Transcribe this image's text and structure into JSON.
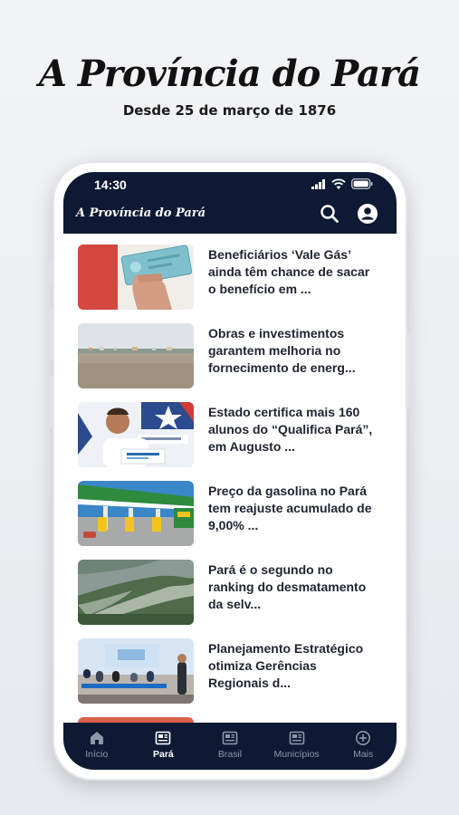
{
  "brand": {
    "logo": "A Província do Pará",
    "tagline": "Desde 25 de março de 1876"
  },
  "status_bar": {
    "time": "14:30"
  },
  "app_bar": {
    "logo": "A Província do Pará",
    "icons": [
      "search-icon",
      "account-icon"
    ]
  },
  "news": [
    {
      "title": "Beneficiários ‘Vale Gás’ ainda têm chance de sacar o benefício em ..."
    },
    {
      "title": "Obras e investimentos garantem melhoria no fornecimento de energ..."
    },
    {
      "title": "Estado certifica mais 160 alunos do “Qualifica Pará”, em Augusto ..."
    },
    {
      "title": "Preço da gasolina no Pará tem reajuste acumulado de 9,00% ..."
    },
    {
      "title": "Pará é o segundo no ranking do desmatamento da selv..."
    },
    {
      "title": "Planejamento Estratégico otimiza Gerências Regionais d..."
    }
  ],
  "nav": [
    {
      "label": "Início",
      "icon": "home-icon",
      "active": false
    },
    {
      "label": "Pará",
      "icon": "news-icon",
      "active": true
    },
    {
      "label": "Brasil",
      "icon": "news-icon",
      "active": false
    },
    {
      "label": "Municípios",
      "icon": "news-icon",
      "active": false
    },
    {
      "label": "Mais",
      "icon": "plus-circle-icon",
      "active": false
    }
  ],
  "colors": {
    "app_bar": "#0e1a33",
    "nav_inactive": "#8e97a8",
    "nav_active": "#ffffff",
    "headline": "#1f2430"
  }
}
